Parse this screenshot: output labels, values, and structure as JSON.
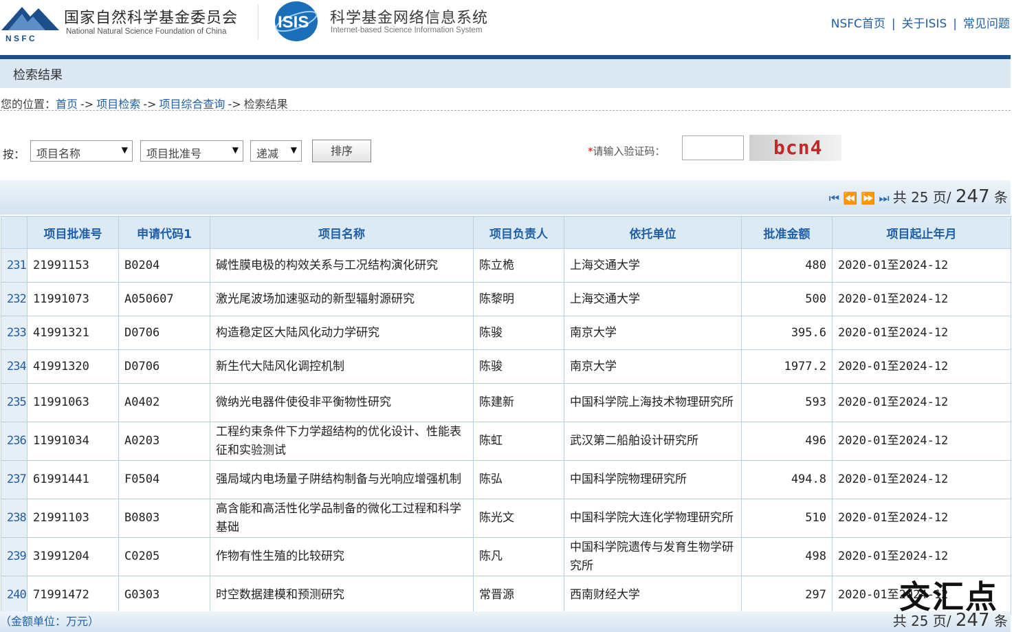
{
  "header": {
    "nsfc_name": "国家自然科学基金委员会",
    "nsfc_en": "National Natural Science Foundation of China",
    "nsfc_abbr": "N S F C",
    "isis_logo_text": "ISIS",
    "isis_name": "科学基金网络信息系统",
    "isis_en": "Internet-based Science Information System",
    "links": [
      "NSFC首页",
      "关于ISIS",
      "常见问题"
    ],
    "brand_color": "#1c4f8a"
  },
  "page_title": "检索结果",
  "breadcrumb": {
    "prefix": "您的位置：",
    "items": [
      "首页",
      "项目检索",
      "项目综合查询"
    ],
    "current": "检索结果",
    "arrow": "->"
  },
  "sort": {
    "label": "按：",
    "field1": "项目名称",
    "field2": "项目批准号",
    "order": "递减",
    "button": "排序",
    "captcha_label": "请输入验证码：",
    "captcha_required": "*",
    "captcha_text": "bcn4"
  },
  "pager": {
    "prefix": "共",
    "pages": "25",
    "middle": "页/",
    "total": "247",
    "suffix": "条",
    "icons": [
      "first-page-icon",
      "prev-page-icon",
      "next-page-icon",
      "last-page-icon"
    ]
  },
  "table": {
    "headers": [
      "",
      "项目批准号",
      "申请代码1",
      "项目名称",
      "项目负责人",
      "依托单位",
      "批准金额",
      "项目起止年月"
    ],
    "rows": [
      {
        "idx": "231",
        "id": "21991153",
        "code": "B0204",
        "name": "碱性膜电极的构效关系与工况结构演化研究",
        "leader": "陈立桅",
        "org": "上海交通大学",
        "amount": "480",
        "period": "2020-01至2024-12"
      },
      {
        "idx": "232",
        "id": "11991073",
        "code": "A050607",
        "name": "激光尾波场加速驱动的新型辐射源研究",
        "leader": "陈黎明",
        "org": "上海交通大学",
        "amount": "500",
        "period": "2020-01至2024-12"
      },
      {
        "idx": "233",
        "id": "41991321",
        "code": "D0706",
        "name": "构造稳定区大陆风化动力学研究",
        "leader": "陈骏",
        "org": "南京大学",
        "amount": "395.6",
        "period": "2020-01至2024-12"
      },
      {
        "idx": "234",
        "id": "41991320",
        "code": "D0706",
        "name": "新生代大陆风化调控机制",
        "leader": "陈骏",
        "org": "南京大学",
        "amount": "1977.2",
        "period": "2020-01至2024-12"
      },
      {
        "idx": "235",
        "id": "11991063",
        "code": "A0402",
        "name": "微纳光电器件使役非平衡物性研究",
        "leader": "陈建新",
        "org": "中国科学院上海技术物理研究所",
        "amount": "593",
        "period": "2020-01至2024-12"
      },
      {
        "idx": "236",
        "id": "11991034",
        "code": "A0203",
        "name": "工程约束条件下力学超结构的优化设计、性能表征和实验测试",
        "leader": "陈虹",
        "org": "武汉第二船舶设计研究所",
        "amount": "496",
        "period": "2020-01至2024-12"
      },
      {
        "idx": "237",
        "id": "61991441",
        "code": "F0504",
        "name": "强局域内电场量子阱结构制备与光响应增强机制",
        "leader": "陈弘",
        "org": "中国科学院物理研究所",
        "amount": "494.8",
        "period": "2020-01至2024-12"
      },
      {
        "idx": "238",
        "id": "21991103",
        "code": "B0803",
        "name": "高含能和高活性化学品制备的微化工过程和科学基础",
        "leader": "陈光文",
        "org": "中国科学院大连化学物理研究所",
        "amount": "510",
        "period": "2020-01至2024-12"
      },
      {
        "idx": "239",
        "id": "31991204",
        "code": "C0205",
        "name": "作物有性生殖的比较研究",
        "leader": "陈凡",
        "org": "中国科学院遗传与发育生物学研究所",
        "amount": "498",
        "period": "2020-01至2024-12"
      },
      {
        "idx": "240",
        "id": "71991472",
        "code": "G0303",
        "name": "时空数据建模和预测研究",
        "leader": "常晋源",
        "org": "西南财经大学",
        "amount": "297",
        "period": "2020-01至2024-12"
      }
    ]
  },
  "footer": {
    "unit_note": "（金额单位：万元）"
  },
  "watermark": "交汇点"
}
